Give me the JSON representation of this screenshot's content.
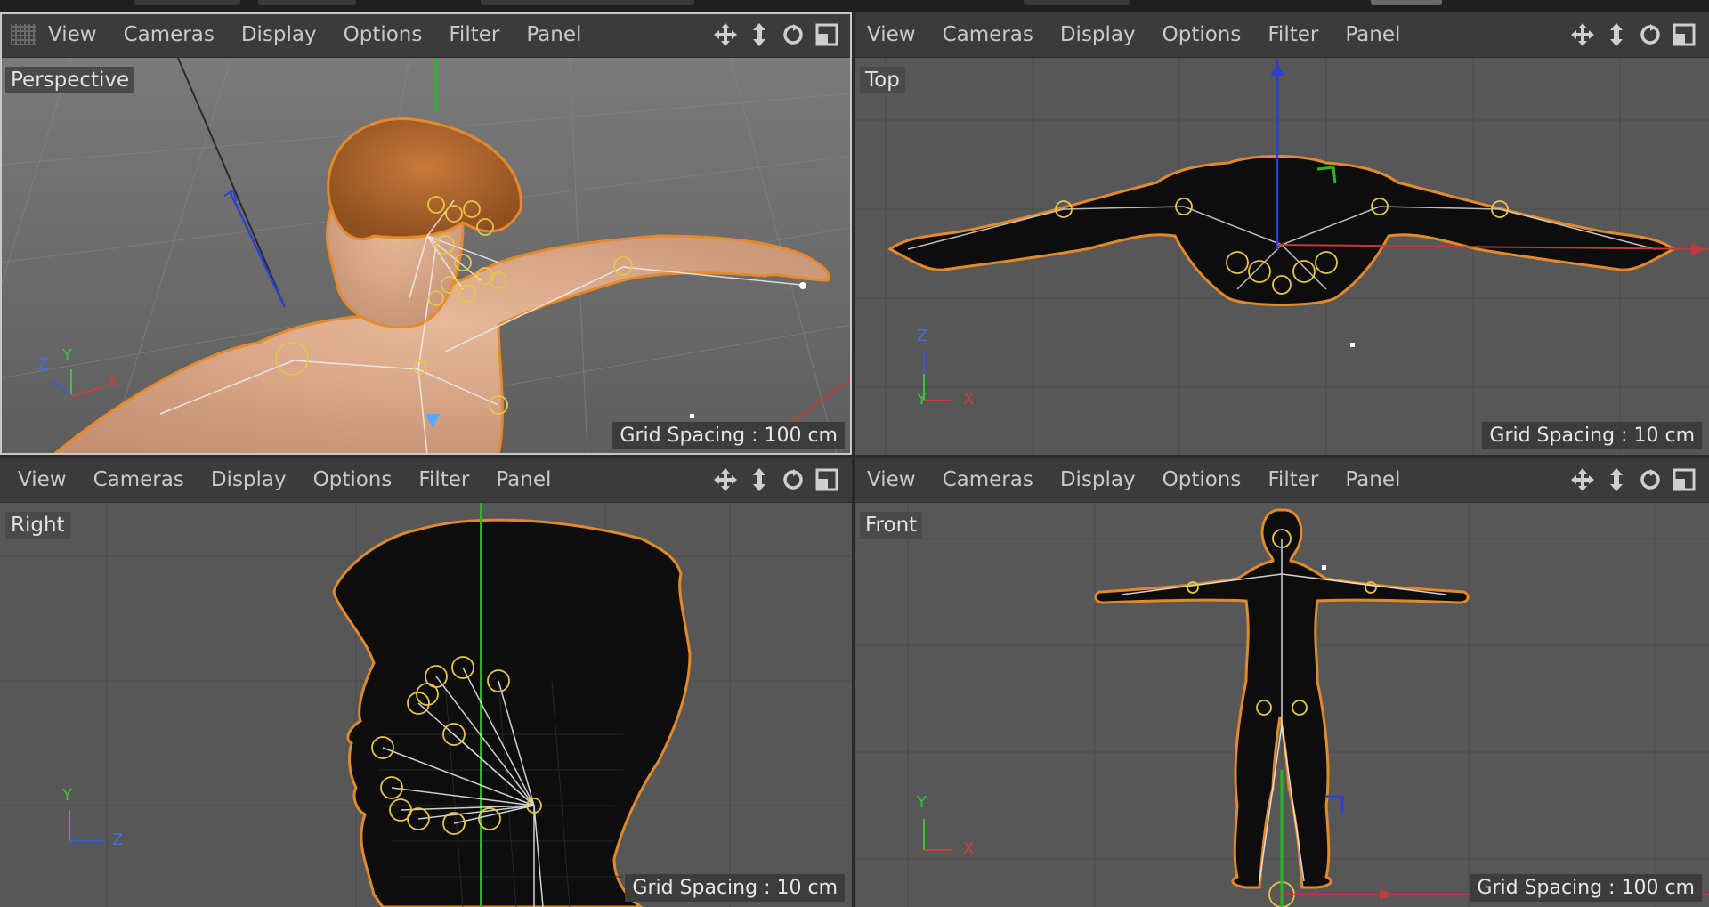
{
  "viewports": [
    {
      "id": "perspective",
      "label": "Perspective",
      "menu": [
        "View",
        "Cameras",
        "Display",
        "Options",
        "Filter",
        "Panel"
      ],
      "grid_spacing": "Grid Spacing : 100 cm",
      "axes": [
        "Z",
        "Y",
        "X"
      ]
    },
    {
      "id": "top",
      "label": "Top",
      "menu": [
        "View",
        "Cameras",
        "Display",
        "Options",
        "Filter",
        "Panel"
      ],
      "grid_spacing": "Grid Spacing : 10 cm",
      "axes": [
        "Z",
        "Y",
        "X"
      ]
    },
    {
      "id": "right",
      "label": "Right",
      "menu": [
        "View",
        "Cameras",
        "Display",
        "Options",
        "Filter",
        "Panel"
      ],
      "grid_spacing": "Grid Spacing : 10 cm",
      "axes": [
        "Y",
        "Z"
      ]
    },
    {
      "id": "front",
      "label": "Front",
      "menu": [
        "View",
        "Cameras",
        "Display",
        "Options",
        "Filter",
        "Panel"
      ],
      "grid_spacing": "Grid Spacing : 100 cm",
      "axes": [
        "Y",
        "X"
      ]
    }
  ],
  "nav_icons": [
    "move-icon",
    "vertical-move-icon",
    "rotate-icon",
    "maximize-icon"
  ],
  "colors": {
    "axis_x": "#d83a3a",
    "axis_y": "#3ec23e",
    "axis_z": "#3a5ad8",
    "selection_outline": "#e08a2a",
    "joint": "#e6c54a"
  }
}
